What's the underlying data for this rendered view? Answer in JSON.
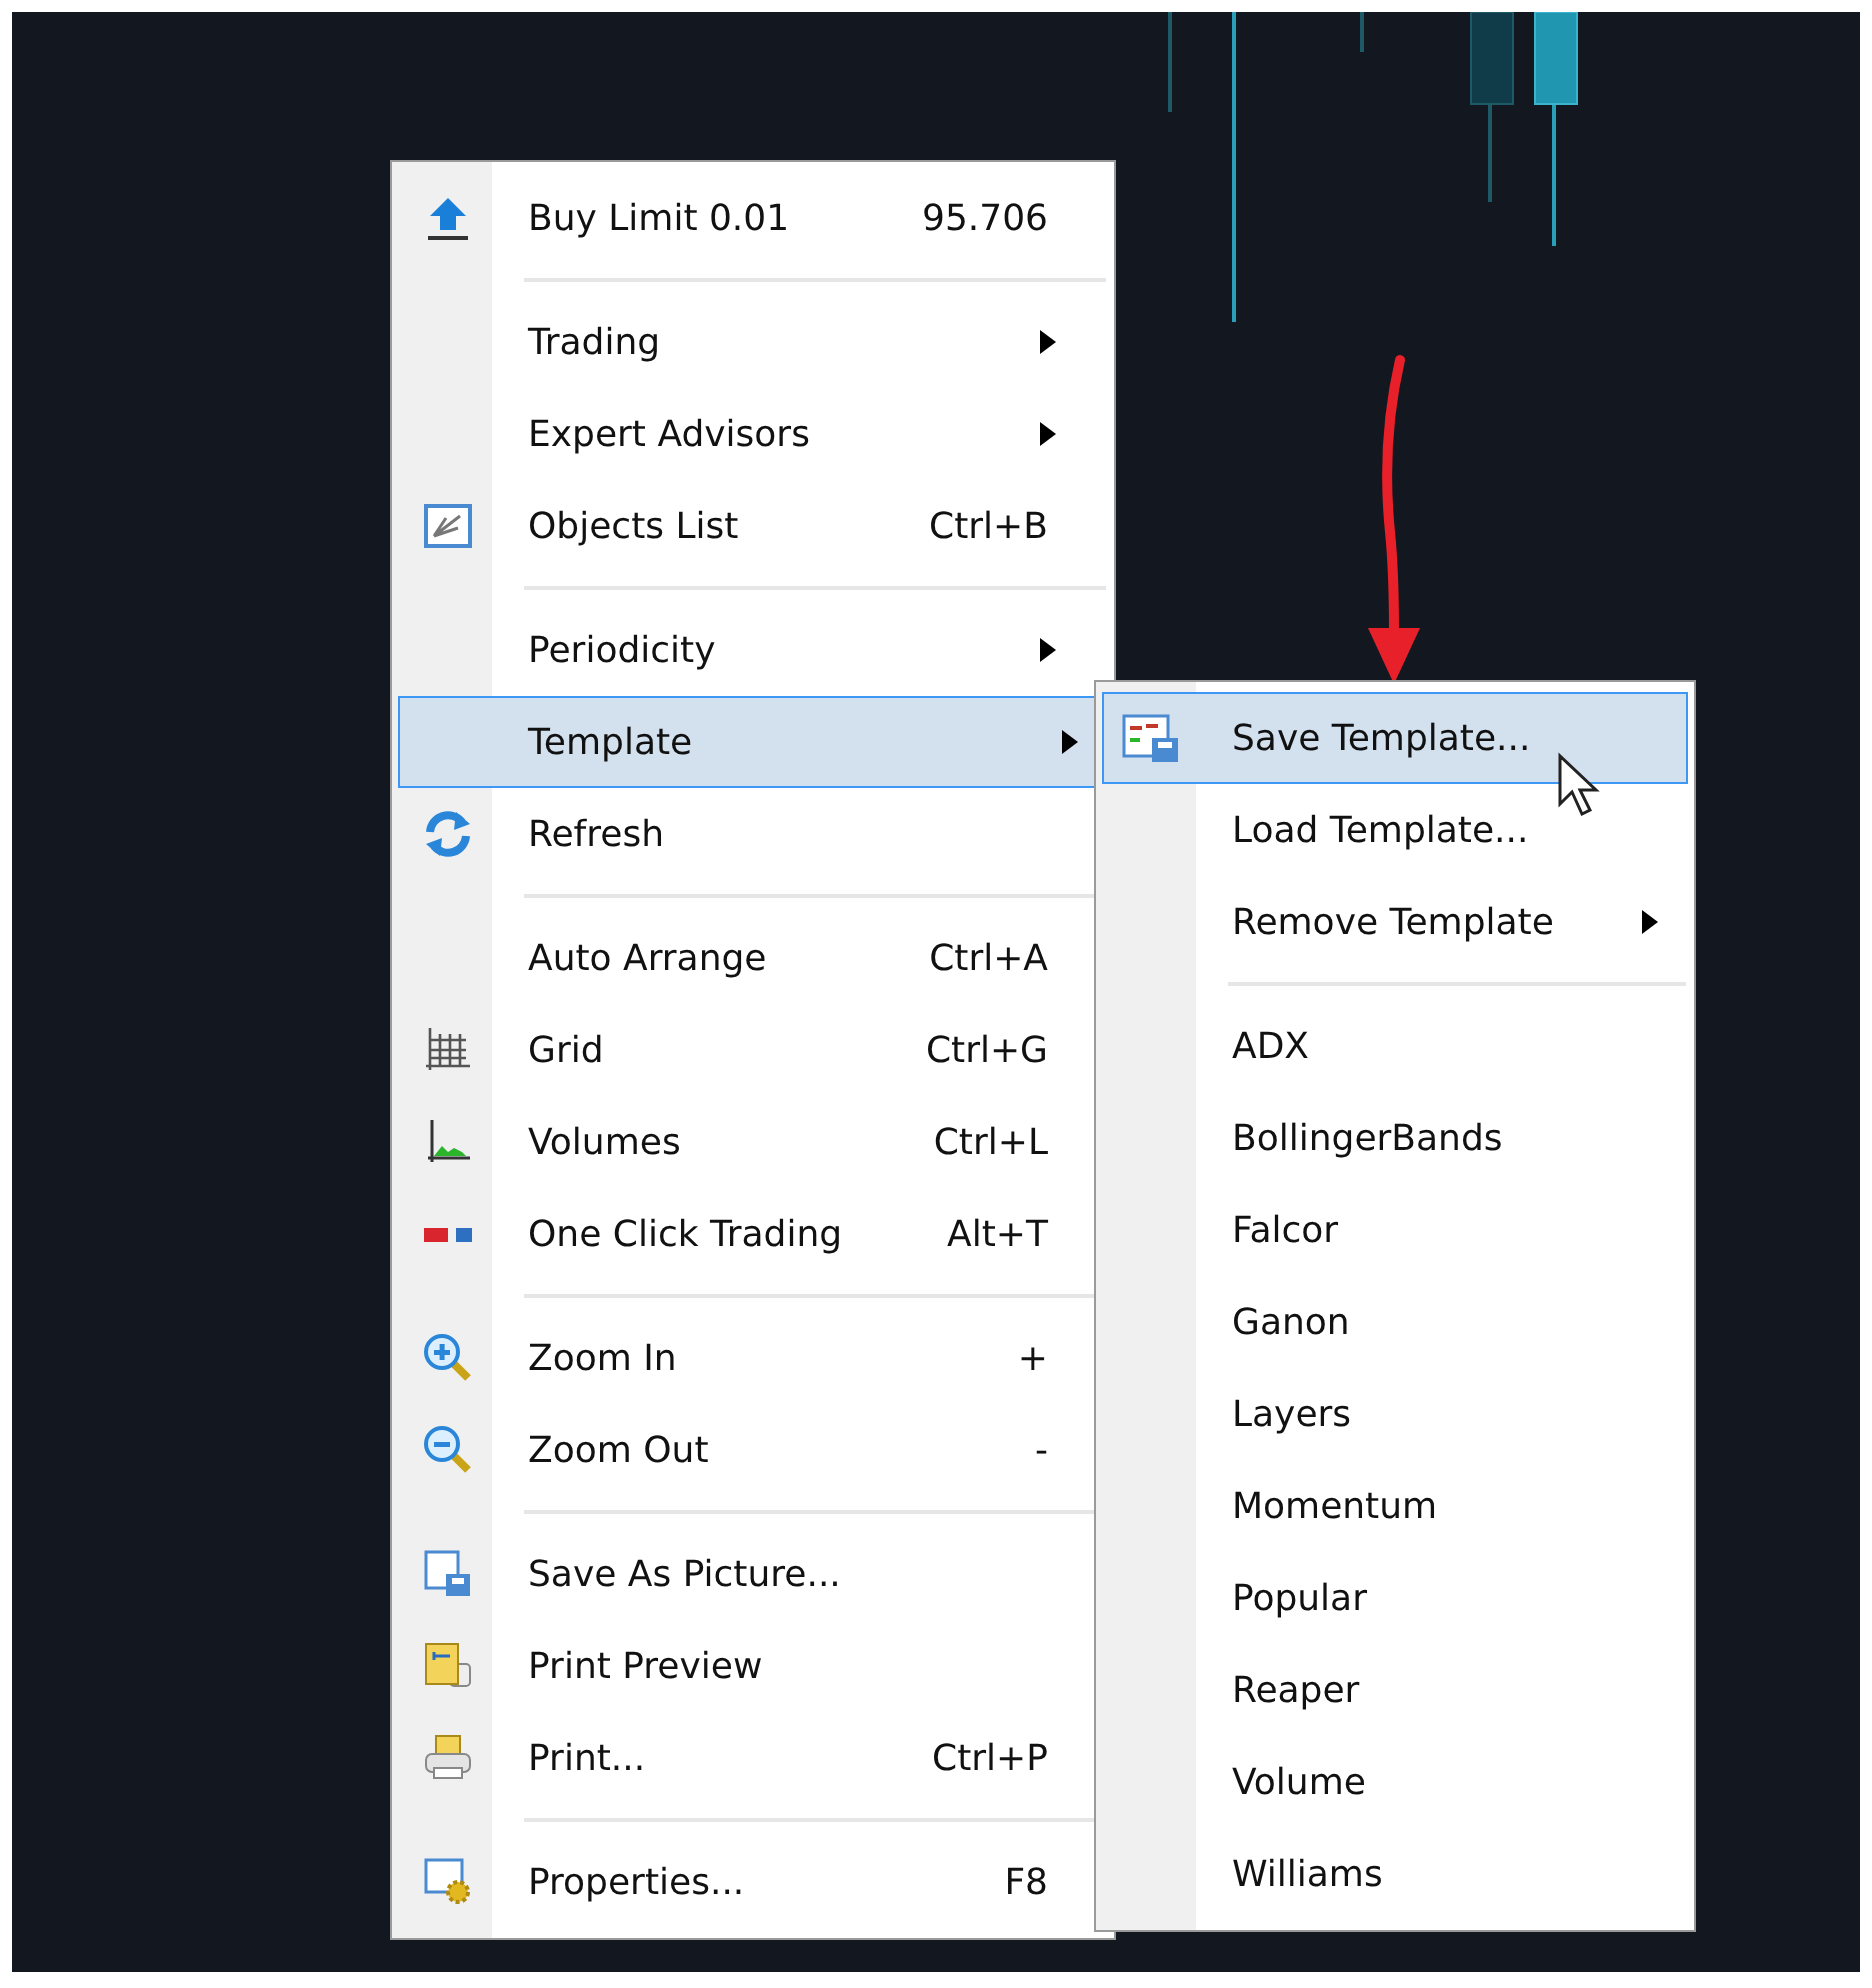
{
  "context_menu": {
    "items": [
      {
        "kind": "item",
        "label": "Buy Limit 0.01",
        "shortcut": "95.706",
        "submenu": false,
        "selected": false
      },
      {
        "kind": "separator"
      },
      {
        "kind": "item",
        "label": "Trading",
        "submenu": true,
        "selected": false
      },
      {
        "kind": "item",
        "label": "Expert Advisors",
        "submenu": true,
        "selected": false
      },
      {
        "kind": "item",
        "label": "Objects List",
        "shortcut": "Ctrl+B",
        "submenu": false,
        "selected": false
      },
      {
        "kind": "separator"
      },
      {
        "kind": "item",
        "label": "Periodicity",
        "submenu": true,
        "selected": false
      },
      {
        "kind": "item",
        "label": "Template",
        "submenu": true,
        "selected": true
      },
      {
        "kind": "item",
        "label": "Refresh",
        "submenu": false,
        "selected": false
      },
      {
        "kind": "separator"
      },
      {
        "kind": "item",
        "label": "Auto Arrange",
        "shortcut": "Ctrl+A",
        "submenu": false,
        "selected": false
      },
      {
        "kind": "item",
        "label": "Grid",
        "shortcut": "Ctrl+G",
        "submenu": false,
        "selected": false
      },
      {
        "kind": "item",
        "label": "Volumes",
        "shortcut": "Ctrl+L",
        "submenu": false,
        "selected": false
      },
      {
        "kind": "item",
        "label": "One Click Trading",
        "shortcut": "Alt+T",
        "submenu": false,
        "selected": false
      },
      {
        "kind": "separator"
      },
      {
        "kind": "item",
        "label": "Zoom In",
        "shortcut": "+",
        "submenu": false,
        "selected": false
      },
      {
        "kind": "item",
        "label": "Zoom Out",
        "shortcut": "-",
        "submenu": false,
        "selected": false
      },
      {
        "kind": "separator"
      },
      {
        "kind": "item",
        "label": "Save As Picture...",
        "submenu": false,
        "selected": false
      },
      {
        "kind": "item",
        "label": "Print Preview",
        "submenu": false,
        "selected": false
      },
      {
        "kind": "item",
        "label": "Print...",
        "shortcut": "Ctrl+P",
        "submenu": false,
        "selected": false
      },
      {
        "kind": "separator"
      },
      {
        "kind": "item",
        "label": "Properties...",
        "shortcut": "F8",
        "submenu": false,
        "selected": false
      }
    ]
  },
  "template_submenu": {
    "items": [
      {
        "kind": "item",
        "label": "Save Template...",
        "submenu": false,
        "selected": true
      },
      {
        "kind": "item",
        "label": "Load Template...",
        "submenu": false,
        "selected": false
      },
      {
        "kind": "item",
        "label": "Remove Template",
        "submenu": true,
        "selected": false
      },
      {
        "kind": "separator"
      },
      {
        "kind": "item",
        "label": "ADX",
        "submenu": false,
        "selected": false
      },
      {
        "kind": "item",
        "label": "BollingerBands",
        "submenu": false,
        "selected": false
      },
      {
        "kind": "item",
        "label": "Falcor",
        "submenu": false,
        "selected": false
      },
      {
        "kind": "item",
        "label": "Ganon",
        "submenu": false,
        "selected": false
      },
      {
        "kind": "item",
        "label": "Layers",
        "submenu": false,
        "selected": false
      },
      {
        "kind": "item",
        "label": "Momentum",
        "submenu": false,
        "selected": false
      },
      {
        "kind": "item",
        "label": "Popular",
        "submenu": false,
        "selected": false
      },
      {
        "kind": "item",
        "label": "Reaper",
        "submenu": false,
        "selected": false
      },
      {
        "kind": "item",
        "label": "Volume",
        "submenu": false,
        "selected": false
      },
      {
        "kind": "item",
        "label": "Williams",
        "submenu": false,
        "selected": false
      }
    ]
  }
}
